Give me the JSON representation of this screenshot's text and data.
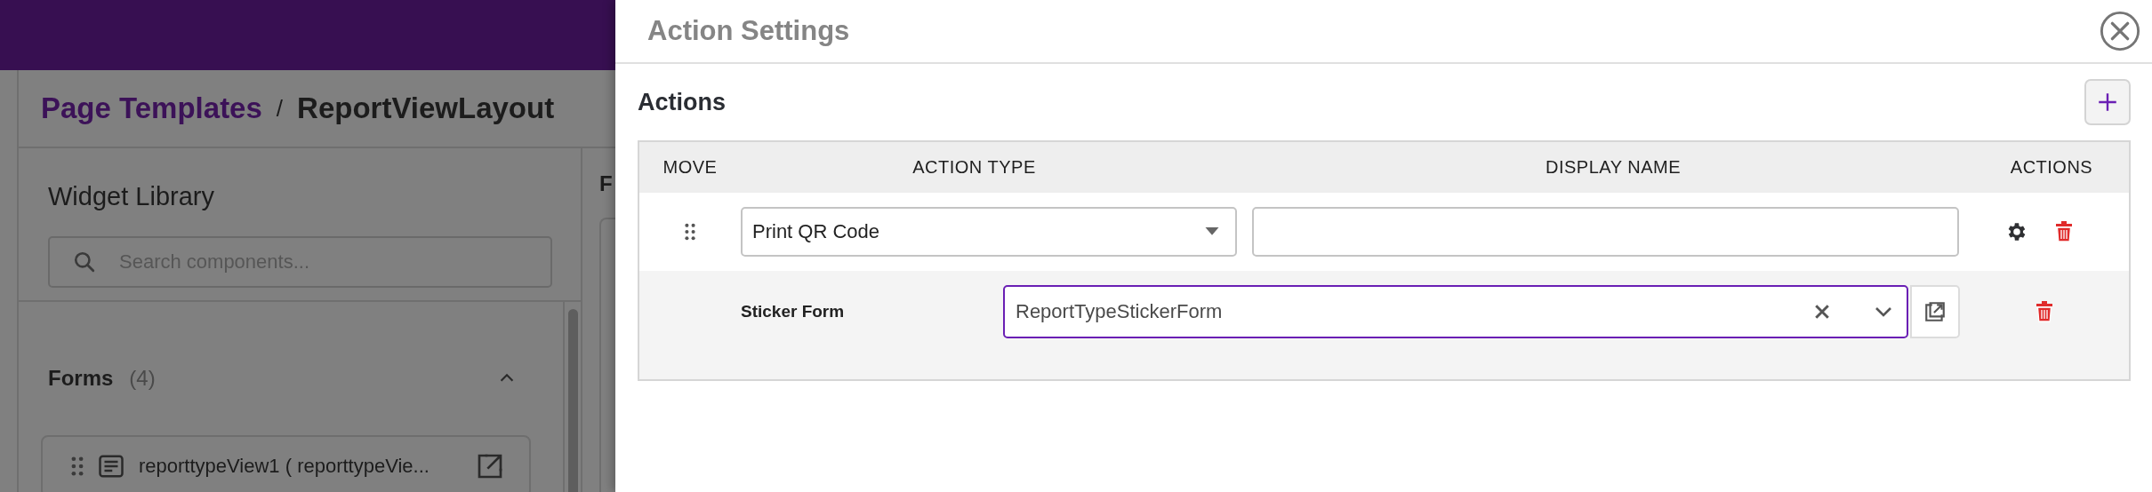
{
  "breadcrumb": {
    "link": "Page Templates",
    "separator": "/",
    "current": "ReportViewLayout"
  },
  "widget_library": {
    "title": "Widget Library",
    "search": {
      "placeholder": "Search components..."
    },
    "sections": [
      {
        "title": "Forms",
        "count": "(4)",
        "expanded": true,
        "items": [
          {
            "label": "reporttypeView1 ( reporttypeVie..."
          }
        ]
      }
    ]
  },
  "canvas_panel": {
    "title": "F"
  },
  "dialog": {
    "title": "Action Settings",
    "section_title": "Actions",
    "table": {
      "columns": [
        "MOVE",
        "ACTION TYPE",
        "DISPLAY NAME",
        "ACTIONS"
      ],
      "rows": [
        {
          "kind": "action",
          "action_type": "Print QR Code"
        },
        {
          "kind": "parameter",
          "label": "Sticker Form",
          "value": "ReportTypeStickerForm",
          "focused": true
        }
      ]
    }
  }
}
